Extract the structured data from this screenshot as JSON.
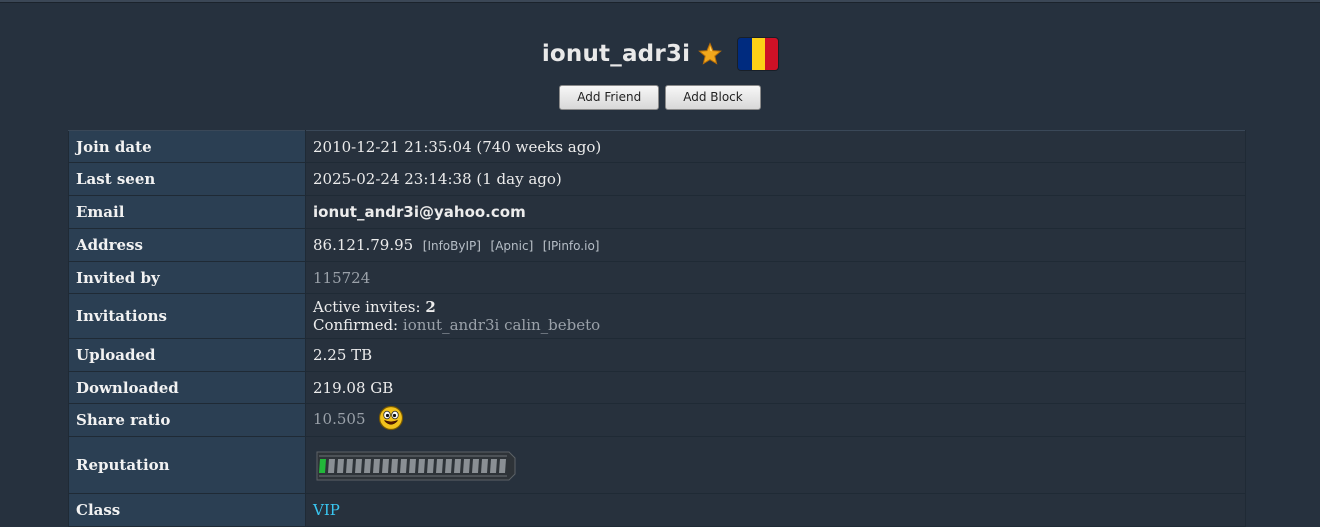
{
  "profile": {
    "username": "ionut_adr3i",
    "star_icon": "star-icon",
    "flag": {
      "name": "romania-flag-icon",
      "colors": [
        "#002b7f",
        "#fcd116",
        "#ce1126"
      ]
    }
  },
  "actions": {
    "add_friend": "Add Friend",
    "add_block": "Add Block"
  },
  "rows": {
    "join_date": {
      "label": "Join date",
      "value": "2010-12-21 21:35:04 (740 weeks ago)"
    },
    "last_seen": {
      "label": "Last seen",
      "value": "2025-02-24 23:14:38 (1 day ago)"
    },
    "email": {
      "label": "Email",
      "value": "ionut_andr3i@yahoo.com"
    },
    "address": {
      "label": "Address",
      "ip": "86.121.79.95",
      "links": [
        "InfoByIP",
        "Apnic",
        "IPinfo.io"
      ]
    },
    "invited_by": {
      "label": "Invited by",
      "value": "115724"
    },
    "invitations": {
      "label": "Invitations",
      "active_label": "Active invites:",
      "active_count": "2",
      "confirmed_label": "Confirmed:",
      "confirmed_users": [
        "ionut_andr3i",
        "calin_bebeto"
      ]
    },
    "uploaded": {
      "label": "Uploaded",
      "value": "2.25 TB"
    },
    "downloaded": {
      "label": "Downloaded",
      "value": "219.08 GB"
    },
    "share_ratio": {
      "label": "Share ratio",
      "value": "10.505",
      "icon": "happy-smiley-icon"
    },
    "reputation": {
      "label": "Reputation",
      "level_fraction": 0.05
    },
    "class": {
      "label": "Class",
      "value": "VIP"
    }
  },
  "colors": {
    "background": "#26313e",
    "label_cell": "#2b3f53",
    "link_cyan": "#39c7f2",
    "reputation_fill": "#22b83a"
  }
}
